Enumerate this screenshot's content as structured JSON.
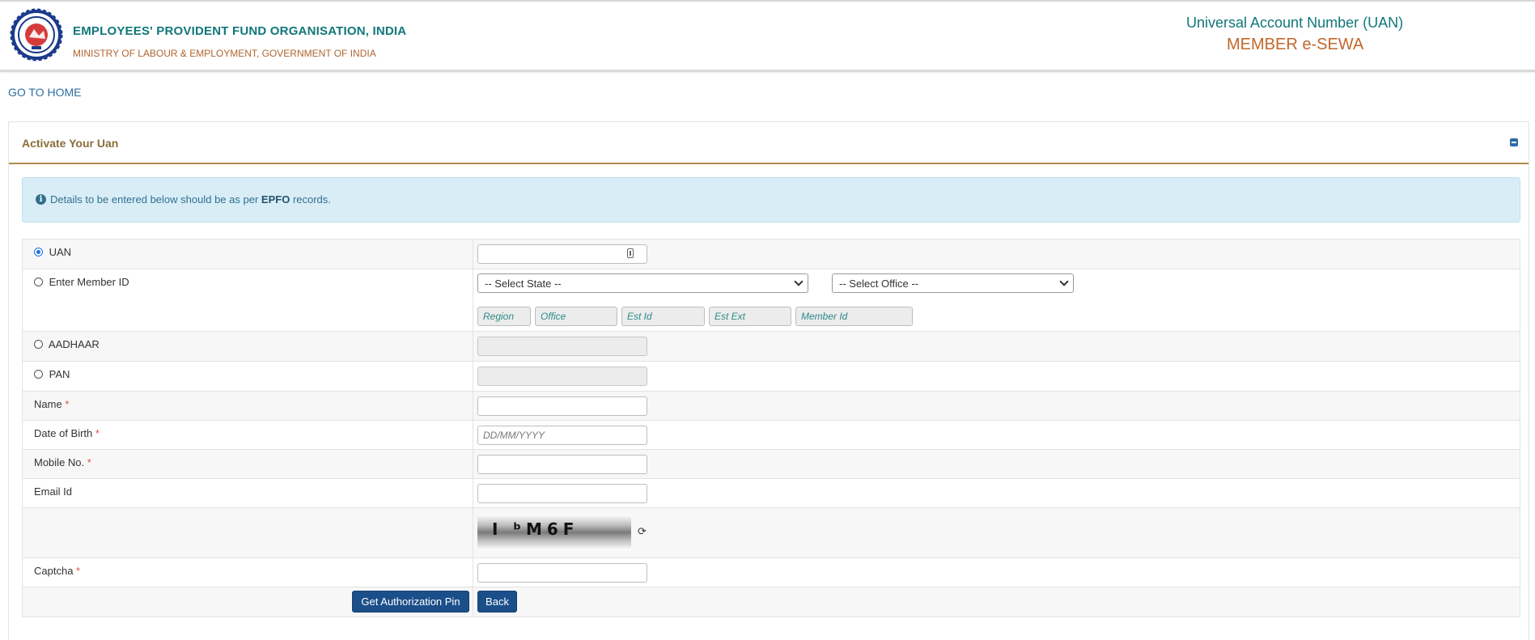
{
  "header": {
    "org_title": "EMPLOYEES' PROVIDENT FUND ORGANISATION, INDIA",
    "org_subtitle": "MINISTRY OF LABOUR & EMPLOYMENT, GOVERNMENT OF INDIA",
    "uan_title": "Universal Account Number (UAN)",
    "portal_name": "MEMBER e-SEWA"
  },
  "nav": {
    "home_link": "GO TO HOME"
  },
  "panel": {
    "title": "Activate Your Uan",
    "notice": {
      "prefix": "Details to be entered below should be as per",
      "bold": "EPFO",
      "suffix": "records."
    }
  },
  "form": {
    "uan_label": "UAN",
    "member_id_label": "Enter Member ID",
    "state_select": "-- Select State --",
    "office_select": "-- Select Office --",
    "member_id_parts": {
      "region": "Region",
      "office": "Office",
      "est_id": "Est Id",
      "est_ext": "Est Ext",
      "member_id": "Member Id"
    },
    "aadhaar_label": "AADHAAR",
    "pan_label": "PAN",
    "name_label": "Name",
    "dob_label": "Date of Birth",
    "dob_placeholder": "DD/MM/YYYY",
    "mobile_label": "Mobile No.",
    "email_label": "Email Id",
    "captcha_label": "Captcha",
    "captcha_text": "I ᵇM6F",
    "required_mark": "*",
    "selected_option": "UAN"
  },
  "buttons": {
    "get_pin": "Get Authorization Pin",
    "back": "Back"
  },
  "colors": {
    "teal": "#11777a",
    "orange": "#c2672a",
    "button": "#1b4f8a",
    "info_bg": "#d9edf7"
  }
}
